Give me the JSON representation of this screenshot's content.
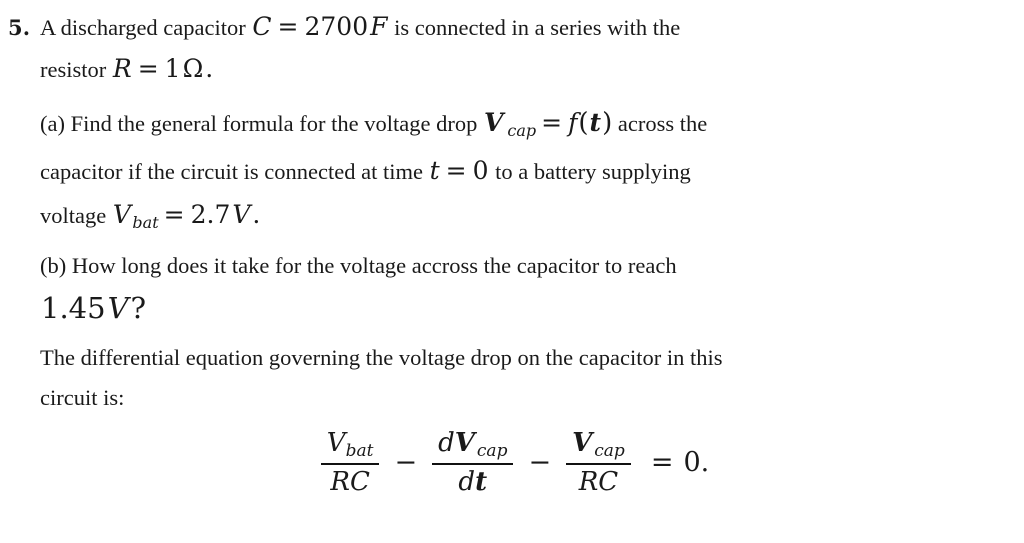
{
  "problem": {
    "number": "5.",
    "statement_lines": {
      "l1_pre": "A discharged capacitor",
      "l1_math": {
        "var_C": "C",
        "eq": "=",
        "value": "2700",
        "unit": "F"
      },
      "l1_post": "is connected in a series with the",
      "l2_pre": "resistor",
      "l2_math": {
        "var_R": "R",
        "eq": "=",
        "value": "1",
        "unit": "Ω",
        "period": "."
      }
    },
    "part_a": {
      "label": "(a)",
      "text_1": "Find the general formula for the voltage drop",
      "math_1": {
        "V": "V",
        "sub": "cap",
        "eq": "=",
        "f": "f",
        "open": "(",
        "t": "t",
        "close": ")"
      },
      "text_2": "across the",
      "text_3": "capacitor if the circuit is connected at time",
      "math_2": {
        "t": "t",
        "eq": "=",
        "zero": "0"
      },
      "text_4": "to a battery supplying",
      "text_5": "voltage",
      "math_3": {
        "V": "V",
        "sub": "bat",
        "eq": "=",
        "value": "2.7",
        "unit": "V",
        "period": "."
      }
    },
    "part_b": {
      "label": "(b)",
      "text_1": "How long does it take for the voltage accross the capacitor to reach",
      "math_1": {
        "value": "1.45",
        "unit": "V",
        "question": "?"
      }
    },
    "closing": {
      "text_1": "The differential equation governing the voltage drop on the capacitor in this",
      "text_2": "circuit is:"
    }
  },
  "equation": {
    "term1": {
      "num_var": "V",
      "num_sub": "bat",
      "den": "RC"
    },
    "op1": "−",
    "term2": {
      "num_d": "d",
      "num_var": "V",
      "num_sub": "cap",
      "den_d": "d",
      "den_var": "t"
    },
    "op2": "−",
    "term3": {
      "num_var": "V",
      "num_sub": "cap",
      "den": "RC"
    },
    "relation": "=",
    "rhs": "0."
  }
}
